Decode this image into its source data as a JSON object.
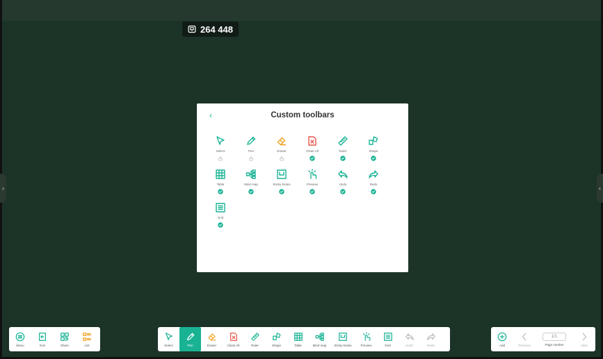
{
  "room": {
    "code": "264 448",
    "icon": "room-icon"
  },
  "dialog": {
    "title": "Custom toolbars",
    "back_glyph": "‹",
    "tools": [
      {
        "label": "Select",
        "icon": "select-icon",
        "status": "locked"
      },
      {
        "label": "Pen",
        "icon": "pen-icon",
        "status": "locked"
      },
      {
        "label": "Eraser",
        "icon": "eraser-icon",
        "status": "locked"
      },
      {
        "label": "Clean All",
        "icon": "clean-all-icon",
        "status": "checked"
      },
      {
        "label": "Ruler",
        "icon": "ruler-icon",
        "status": "checked"
      },
      {
        "label": "Shape",
        "icon": "shape-icon",
        "status": "checked"
      },
      {
        "label": "Table",
        "icon": "table-icon",
        "status": "checked"
      },
      {
        "label": "Mind map",
        "icon": "mind-map-icon",
        "status": "checked"
      },
      {
        "label": "Sticky-Notes",
        "icon": "sticky-notes-icon",
        "status": "checked"
      },
      {
        "label": "Preview",
        "icon": "preview-icon",
        "status": "checked"
      },
      {
        "label": "Undo",
        "icon": "undo-icon",
        "status": "checked"
      },
      {
        "label": "Redo",
        "icon": "redo-icon",
        "status": "checked"
      },
      {
        "label": "Grid",
        "icon": "grid-icon",
        "status": "checked"
      }
    ]
  },
  "left_bar": {
    "items": [
      {
        "label": "Menu",
        "icon": "menu-icon"
      },
      {
        "label": "Exit",
        "icon": "exit-icon"
      },
      {
        "label": "Share",
        "icon": "share-icon"
      },
      {
        "label": "List",
        "icon": "list-icon"
      }
    ]
  },
  "toolbar": {
    "items": [
      {
        "label": "Select",
        "icon": "select-icon"
      },
      {
        "label": "Pen",
        "icon": "pen-icon",
        "active": true
      },
      {
        "label": "Eraser",
        "icon": "eraser-icon"
      },
      {
        "label": "Clean All",
        "icon": "clean-all-icon"
      },
      {
        "label": "Ruler",
        "icon": "ruler-icon"
      },
      {
        "label": "Shape",
        "icon": "shape-icon"
      },
      {
        "label": "Table",
        "icon": "table-icon"
      },
      {
        "label": "Mind map",
        "icon": "mind-map-icon"
      },
      {
        "label": "Sticky-Notes",
        "icon": "sticky-notes-icon"
      },
      {
        "label": "Preview",
        "icon": "preview-icon"
      },
      {
        "label": "Grid",
        "icon": "grid-icon"
      },
      {
        "label": "Undo",
        "icon": "undo-icon",
        "disabled": true
      },
      {
        "label": "Redo",
        "icon": "redo-icon",
        "disabled": true
      }
    ]
  },
  "page_nav": {
    "add_label": "Add",
    "previous_label": "Previous",
    "page_label": "Page number",
    "page_value": "1/1",
    "next_label": "Next"
  },
  "colors": {
    "accent": "#19b394",
    "eraser": "#f0a020",
    "clean_all": "#e8554a",
    "list": "#f0a020",
    "background": "#1c3328",
    "disabled": "#bbbbbb"
  }
}
